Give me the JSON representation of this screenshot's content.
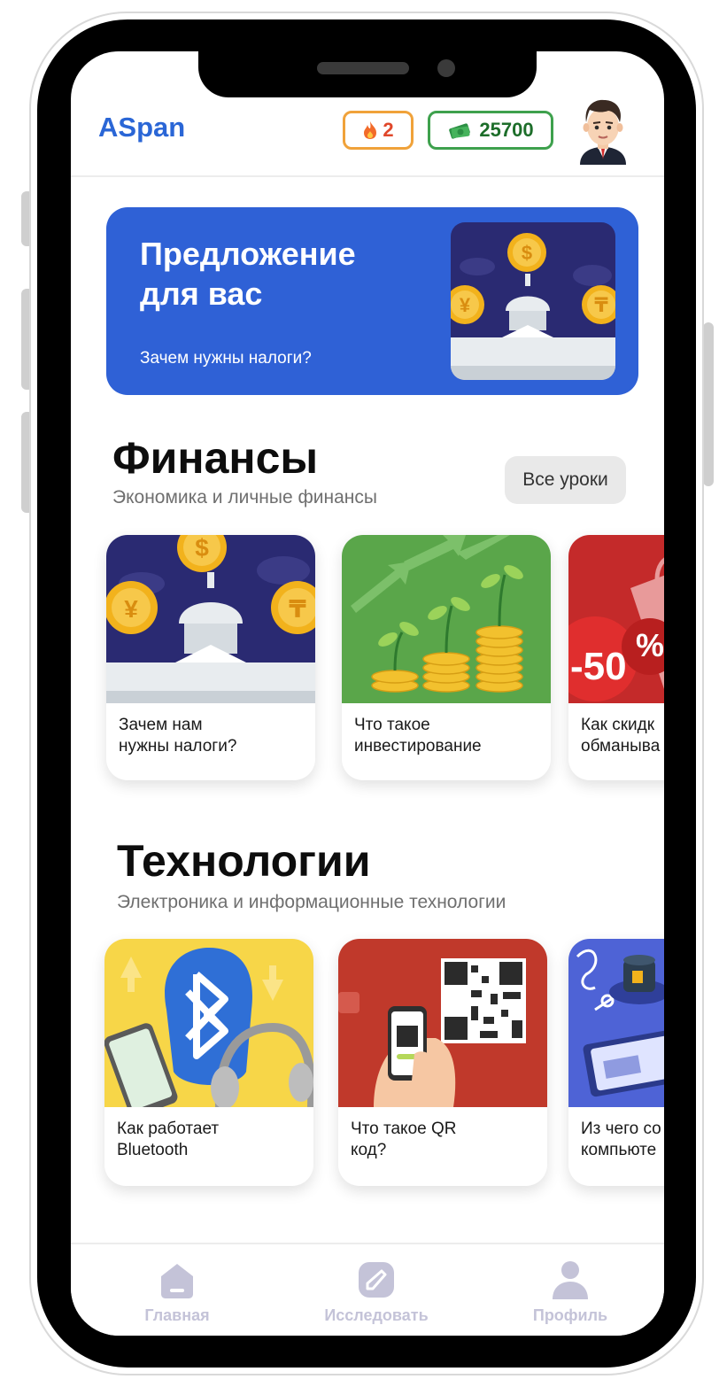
{
  "header": {
    "app_title": "ASpan",
    "streak_count": "2",
    "coins_count": "25700",
    "streak_icon": "fire-icon",
    "coins_icon": "money-icon"
  },
  "banner": {
    "title": "Предложение для вас",
    "subtitle": "Зачем нужны налоги?"
  },
  "finance": {
    "title": "Финансы",
    "subtitle": "Экономика и личные финансы",
    "all_lessons": "Все уроки",
    "cards": [
      {
        "label": "Зачем нам\nнужны налоги?"
      },
      {
        "label": "Что такое\nинвестирование"
      },
      {
        "label": "Как скидк\nобманыва",
        "badge": "-50",
        "badge_percent": "%"
      }
    ]
  },
  "tech": {
    "title": "Технологии",
    "subtitle": "Электроника и информационные технологии",
    "cards": [
      {
        "label": "Как работает\nBluetooth"
      },
      {
        "label": "Что такое QR\nкод?"
      },
      {
        "label": "Из чего со\nкомпьюте"
      }
    ]
  },
  "nav": {
    "items": [
      {
        "label": "Главная",
        "icon": "home-icon"
      },
      {
        "label": "Исследовать",
        "icon": "compass-icon"
      },
      {
        "label": "Профиль",
        "icon": "profile-icon"
      }
    ]
  },
  "colors": {
    "brand": "#2a66d6",
    "banner": "#2f61d6",
    "nav_inactive": "#c4c3d8"
  }
}
